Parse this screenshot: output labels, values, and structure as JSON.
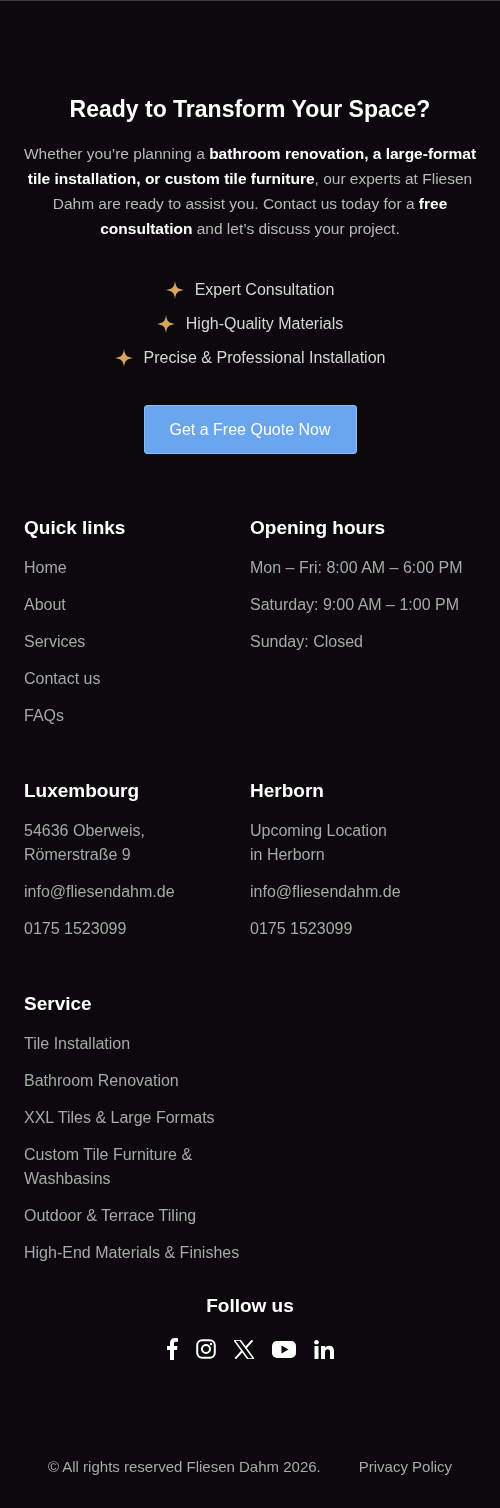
{
  "cta": {
    "title": "Ready to Transform Your Space?",
    "text": "Whether you’re planning a **bathroom renovation, a large-format tile installation, or custom tile furniture**, our experts at Fliesen Dahm are ready to assist you. Contact us today for a **free consultation** and let’s discuss your project.",
    "features": [
      "Expert Consultation",
      "High-Quality Materials",
      "Precise & Professional Installation"
    ],
    "button": "Get a Free Quote Now"
  },
  "footer": {
    "columns": [
      {
        "title": "Quick links",
        "kind": "links",
        "items": [
          "Home",
          "About",
          "Services",
          "Contact us",
          "FAQs"
        ]
      },
      {
        "title": "Opening hours",
        "kind": "text",
        "items": [
          "Mon – Fri: 8:00 AM – 6:00 PM",
          "Saturday: 9:00 AM – 1:00 PM",
          "Sunday: Closed"
        ]
      },
      {
        "title": "Luxembourg",
        "kind": "text",
        "items": [
          "54636 Oberweis, Römerstraße 9",
          "info@fliesendahm.de",
          "0175 1523099"
        ]
      },
      {
        "title": "Herborn",
        "kind": "text",
        "items": [
          "Upcoming Location in Herborn",
          "info@fliesendahm.de",
          "0175 1523099"
        ]
      },
      {
        "title": "Service",
        "kind": "links",
        "items": [
          "Tile Installation",
          "Bathroom Renovation",
          "XXL Tiles & Large Formats",
          "Custom Tile Furniture & Washbasins",
          "Outdoor & Terrace Tiling",
          "High-End Materials & Finishes"
        ]
      }
    ],
    "follow": {
      "title": "Follow us",
      "networks": [
        {
          "kind": "facebook"
        },
        {
          "kind": "instagram"
        },
        {
          "kind": "x"
        },
        {
          "kind": "youtube"
        },
        {
          "kind": "linkedin"
        }
      ]
    },
    "copyright": "© All rights reserved Fliesen Dahm 2026.",
    "privacy": "Privacy Policy"
  }
}
